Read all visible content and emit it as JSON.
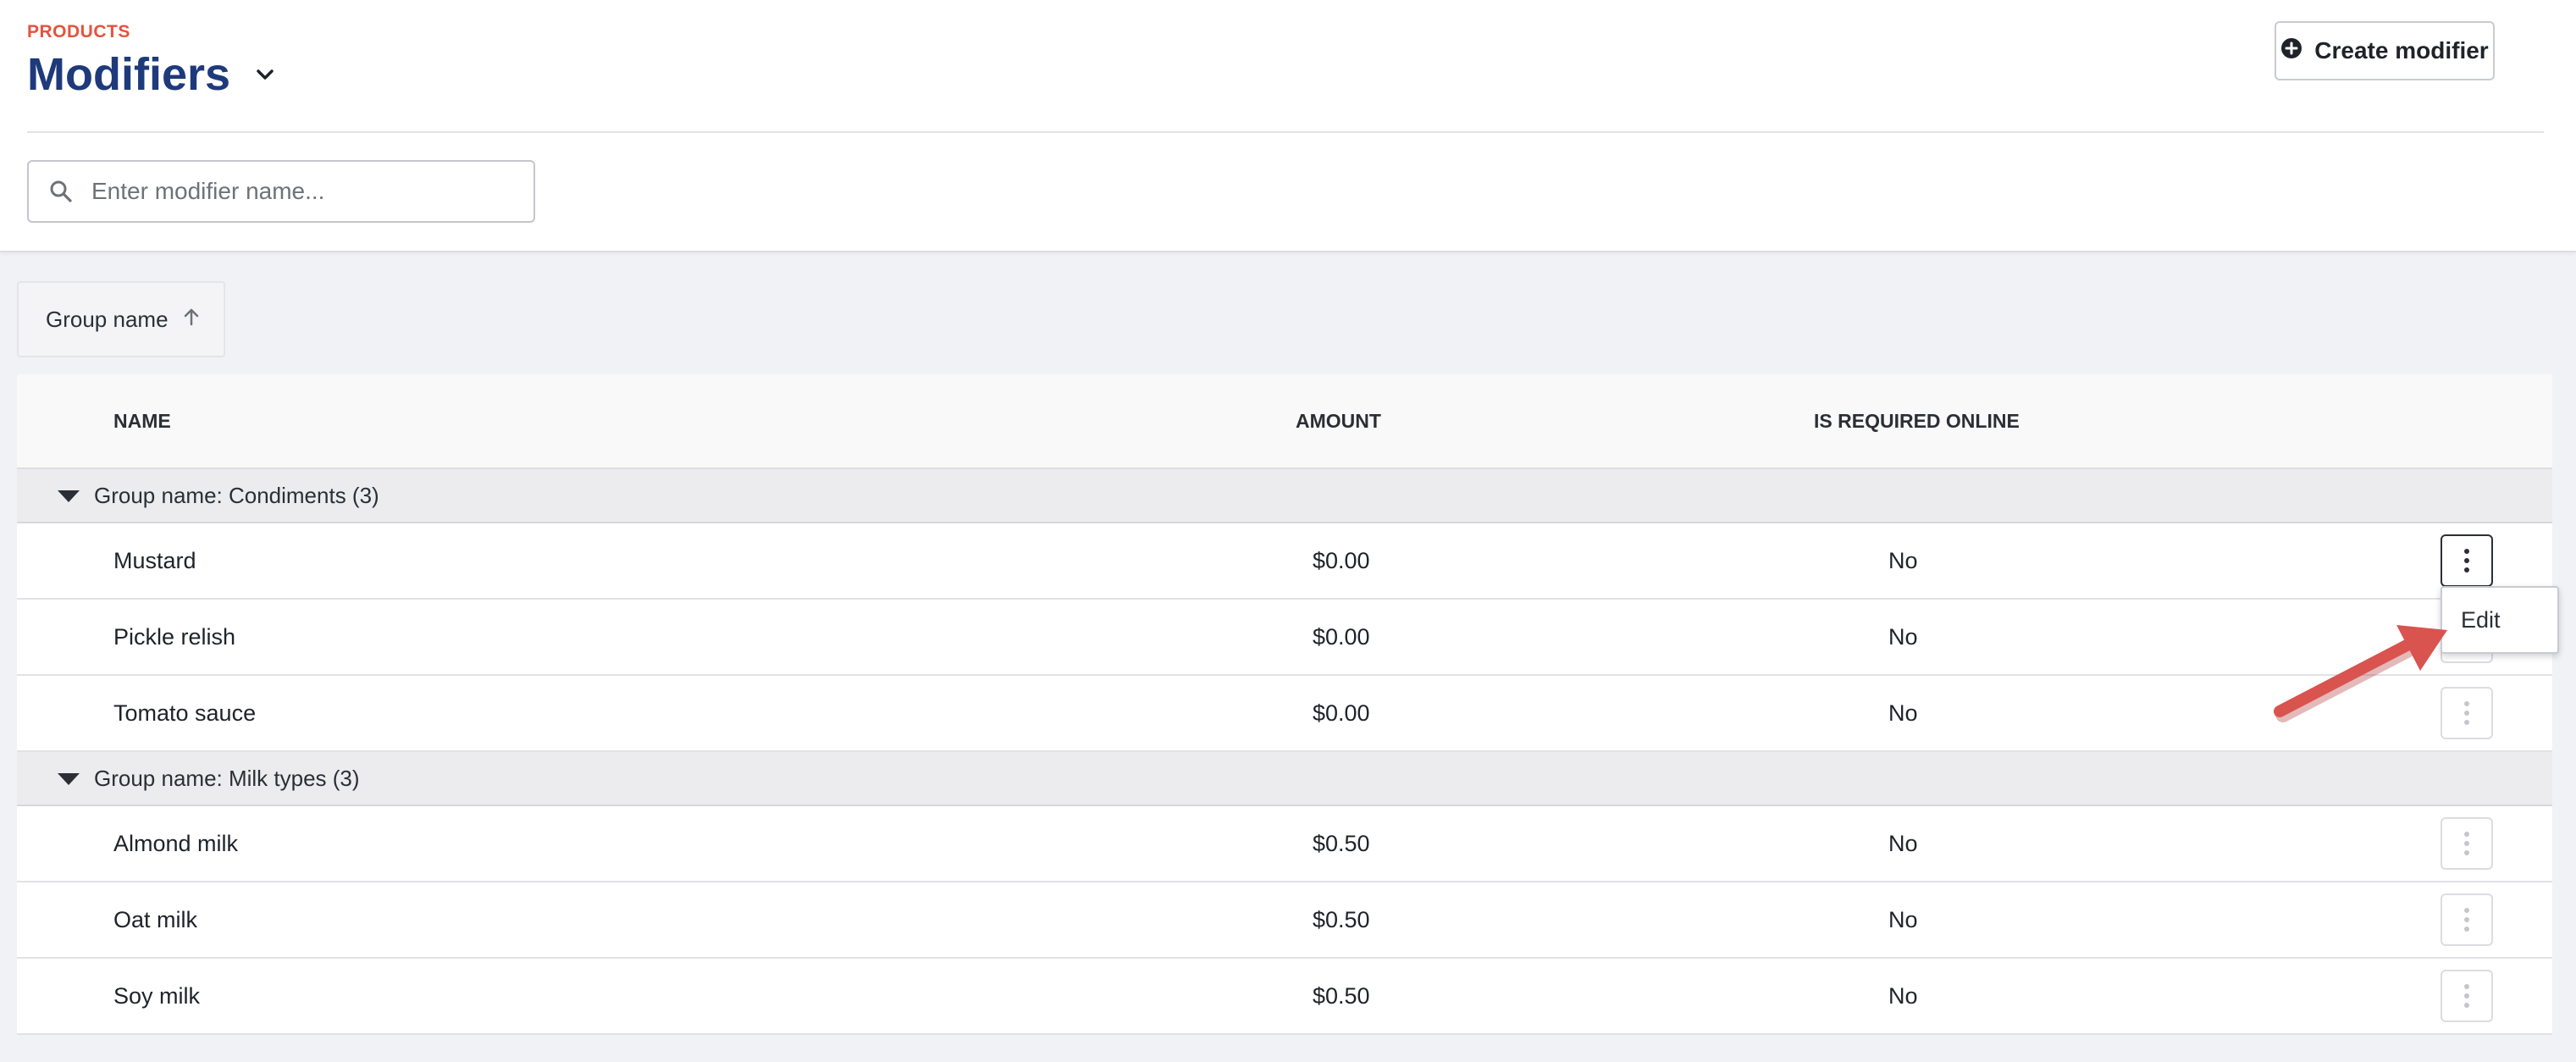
{
  "header": {
    "eyebrow": "PRODUCTS",
    "title": "Modifiers",
    "create_label": "Create modifier"
  },
  "search": {
    "placeholder": "Enter modifier name...",
    "value": ""
  },
  "sort_chip": {
    "label": "Group name",
    "direction": "ascending"
  },
  "table": {
    "columns": {
      "name": "NAME",
      "amount": "AMOUNT",
      "required": "IS REQUIRED ONLINE"
    },
    "groups": [
      {
        "label": "Group name: Condiments (3)",
        "rows": [
          {
            "name": "Mustard",
            "amount": "$0.00",
            "required": "No"
          },
          {
            "name": "Pickle relish",
            "amount": "$0.00",
            "required": "No"
          },
          {
            "name": "Tomato sauce",
            "amount": "$0.00",
            "required": "No"
          }
        ]
      },
      {
        "label": "Group name: Milk types (3)",
        "rows": [
          {
            "name": "Almond milk",
            "amount": "$0.50",
            "required": "No"
          },
          {
            "name": "Oat milk",
            "amount": "$0.50",
            "required": "No"
          },
          {
            "name": "Soy milk",
            "amount": "$0.50",
            "required": "No"
          }
        ]
      }
    ]
  },
  "row_menu": {
    "edit_label": "Edit"
  },
  "colors": {
    "eyebrow": "#e5533d",
    "title": "#1e3a7b",
    "annotation_arrow": "#d9534f"
  },
  "icons": [
    "chevron-down-icon",
    "plus-circle-icon",
    "search-icon",
    "arrow-up-icon",
    "caret-down-icon",
    "more-vertical-icon"
  ]
}
